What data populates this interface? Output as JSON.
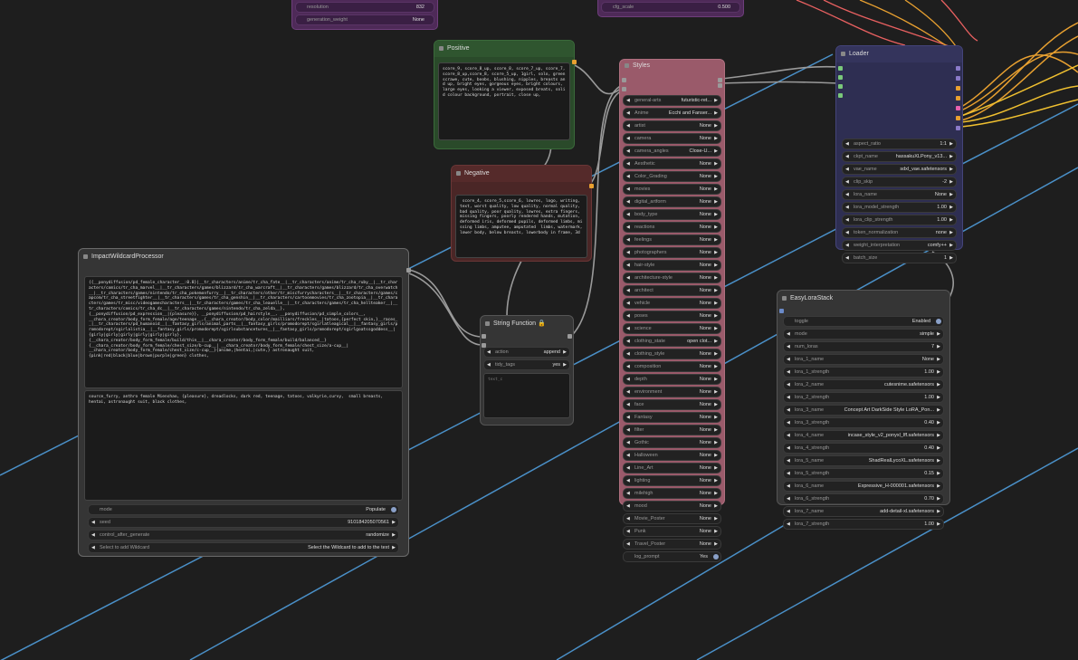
{
  "top_fragments": [
    {
      "label": "resolution",
      "value": "832"
    },
    {
      "label": "generation_weight",
      "value": "None"
    },
    {
      "label": "cfg_scale",
      "value": "0.500"
    }
  ],
  "positive": {
    "title": "Positive",
    "text": "score_9, score_8_up, score_8, score_7_up, score_7, score_8_up,score_8, score_5_up, 1girl, solo, green scrawe, cute, boobs, blushing, nipples, breasts and up, bright eyes, gorgeous eyes, bright colours, large eyes, looking a viewer, exposed breats, solid colour background, portrait, close up,"
  },
  "negative": {
    "title": "Negative",
    "text": " score_4, score_5,score_6, lowres, logo, writing, text, worst quality, low quality, normal quality, bad quality, poor quality, lowres, extra fingers, missing fingers, poorly rendered hands, mutation, deformed iris, deformed pupils, deformed limbs, missing limbs, amputee, amputated  limbs, watermark, lower body, below breasts, lowerbody in frame, 3d"
  },
  "wildcard": {
    "title": "ImpactWildcardProcessor",
    "text1": "{{__ponydiffusion/pd_female_character__:0.8}|__tr_characters/anime/tr_cha_fate__|__tr_characters/anime/tr_cha_ruby__|__tr_characters/comics/tr_cha_marvel__|__tr_characters/games/blizzard/tr_cha_warcraft__|__tr_characters/games/blizzard/tr_cha_overwatch__|__tr_characters/games/nintendo/tr_cha_pokemonfurry__|__tr_characters/other/tr_miscfurrycharacters__|__tr_characters/games/capcom/tr_cha_streetfighter__|__tr_characters/games/tr_cha_genshin__|__tr_characters/cartoonmovies/tr_cha_zootopia__|__tr_characters/games/tr_misc/videogamecharacters__|__tr_characters/games/tr_cha_leauelle__|__tr_characters/games/tr_cha_hellteaker__|__tr_characters/comics/tr_cha_dc__|__tr_characters/games/nintendo/tr_cha_zelda__},\n{__ponydiffusion/pd_expression__|{pleasure}}, __ponydiffusion/pd_hairstyle__, __ponydiffusion/pd_simple_colors__,\n__chara_creator/body_form_female/age/teenage__,{__chara_creator/body_color/mailliars/freckles__|tatoos,{perfect skin,}__races__|__tr_characters/pd_humanoid__|__fantasy_girls/animal_parts__|__fantasy_girls/promodorept/sgirlatleagical__|__fantasy_girls/promodorept/sgirlalistia__|__fantasy_girls/promodorept/sgirlsubstancetures__|__fantasy_girls/promodorept/sgirlgoatssgoddess__|{girly|girly|girly|girly|girly|girly},\n{__chara_creator/body_form_female/build/thin__|__chara_creator/body_form_female/build/balanced__}\n{__chara_creator/body_form_female/chest_size/b-cup__| __chara_creator/body_form_female/chest_size/a-cup__|\n__chara_creator/body_form_female/chest_size/c-cup__}{anime,|hentai,|cute,} astronaught suit,\n{pink|red|black|blue|brown|purple|green} clothes,",
    "text2": "source_furry, anthro female Mienshao, {pleasure}, dreadlocks, dark red, teenage, tatoos, valkyrie,curvy,  small breasts,\nhentai, astronaught suit, black clothes,",
    "widgets": [
      {
        "label": "mode",
        "value": "Populate",
        "type": "toggle"
      },
      {
        "label": "seed",
        "value": "910184205070561",
        "type": "number"
      },
      {
        "label": "control_after_generate",
        "value": "randomize",
        "type": "combo"
      },
      {
        "label": "Select to add Wildcard",
        "value": "Select the Wildcard to add to the text",
        "type": "combo"
      }
    ]
  },
  "string_function": {
    "title": "String Function",
    "widgets": [
      {
        "label": "action",
        "value": "append"
      },
      {
        "label": "tidy_tags",
        "value": "yes"
      }
    ],
    "text": "text_c"
  },
  "styles": {
    "title": "Styles",
    "widgets": [
      {
        "label": "general-arts",
        "value": "futuristic-ret..."
      },
      {
        "label": "Anime",
        "value": "Ecchi and Fanser..."
      },
      {
        "label": "artist",
        "value": "None"
      },
      {
        "label": "camera",
        "value": "None"
      },
      {
        "label": "camera_angles",
        "value": "Close-U..."
      },
      {
        "label": "Aesthetic",
        "value": "None"
      },
      {
        "label": "Color_Grading",
        "value": "None"
      },
      {
        "label": "movies",
        "value": "None"
      },
      {
        "label": "digital_artform",
        "value": "None"
      },
      {
        "label": "body_type",
        "value": "None"
      },
      {
        "label": "reactions",
        "value": "None"
      },
      {
        "label": "feelings",
        "value": "None"
      },
      {
        "label": "photographers",
        "value": "None"
      },
      {
        "label": "hair-style",
        "value": "None"
      },
      {
        "label": "architecture-style",
        "value": "None"
      },
      {
        "label": "architect",
        "value": "None"
      },
      {
        "label": "vehicle",
        "value": "None"
      },
      {
        "label": "poses",
        "value": "None"
      },
      {
        "label": "science",
        "value": "None"
      },
      {
        "label": "clothing_state",
        "value": "open clot..."
      },
      {
        "label": "clothing_style",
        "value": "None"
      },
      {
        "label": "composition",
        "value": "None"
      },
      {
        "label": "depth",
        "value": "None"
      },
      {
        "label": "environment",
        "value": "None"
      },
      {
        "label": "face",
        "value": "None"
      },
      {
        "label": "Fantasy",
        "value": "None"
      },
      {
        "label": "filter",
        "value": "None"
      },
      {
        "label": "Gothic",
        "value": "None"
      },
      {
        "label": "Halloween",
        "value": "None"
      },
      {
        "label": "Line_Art",
        "value": "None"
      },
      {
        "label": "lighting",
        "value": "None"
      },
      {
        "label": "milehigh",
        "value": "None"
      },
      {
        "label": "mood",
        "value": "None"
      },
      {
        "label": "Movie_Poster",
        "value": "None"
      },
      {
        "label": "Punk",
        "value": "None"
      },
      {
        "label": "Travel_Poster",
        "value": "None"
      }
    ],
    "log_prompt": {
      "label": "log_prompt",
      "value": "Yes"
    }
  },
  "loader": {
    "title": "Loader",
    "widgets": [
      {
        "label": "aspect_ratio",
        "value": "1:1"
      },
      {
        "label": "ckpt_name",
        "value": "hassakuXLPony_v13..."
      },
      {
        "label": "vae_name",
        "value": "sdxl_vae.safetensors"
      },
      {
        "label": "clip_skip",
        "value": "-2"
      },
      {
        "label": "lora_name",
        "value": "None"
      },
      {
        "label": "lora_model_strength",
        "value": "1.00"
      },
      {
        "label": "lora_clip_strength",
        "value": "1.00"
      },
      {
        "label": "token_normalization",
        "value": "none"
      },
      {
        "label": "weight_interpretation",
        "value": "comfy++"
      },
      {
        "label": "batch_size",
        "value": "1"
      }
    ]
  },
  "lora_stack": {
    "title": "EasyLoraStack",
    "toggle": {
      "label": "toggle",
      "value": "Enabled"
    },
    "widgets": [
      {
        "label": "mode",
        "value": "simple"
      },
      {
        "label": "num_loras",
        "value": "7"
      },
      {
        "label": "lora_1_name",
        "value": "None"
      },
      {
        "label": "lora_1_strength",
        "value": "1.00"
      },
      {
        "label": "lora_2_name",
        "value": "cutesnime.safetensors"
      },
      {
        "label": "lora_2_strength",
        "value": "1.00"
      },
      {
        "label": "lora_3_name",
        "value": "Concept Art DarkSide Style LoRA_Pon..."
      },
      {
        "label": "lora_3_strength",
        "value": "0.40"
      },
      {
        "label": "lora_4_name",
        "value": "incase_style_v2_ponyxl_lff.safetensors"
      },
      {
        "label": "lora_4_strength",
        "value": "0.40"
      },
      {
        "label": "lora_5_name",
        "value": "ShadRealLycoXL.safetensors"
      },
      {
        "label": "lora_5_strength",
        "value": "0.15"
      },
      {
        "label": "lora_6_name",
        "value": "Expressive_H-000001.safetensors"
      },
      {
        "label": "lora_6_strength",
        "value": "0.70"
      },
      {
        "label": "lora_7_name",
        "value": "add-detail-xl.safetensors"
      },
      {
        "label": "lora_7_strength",
        "value": "1.00"
      }
    ]
  }
}
